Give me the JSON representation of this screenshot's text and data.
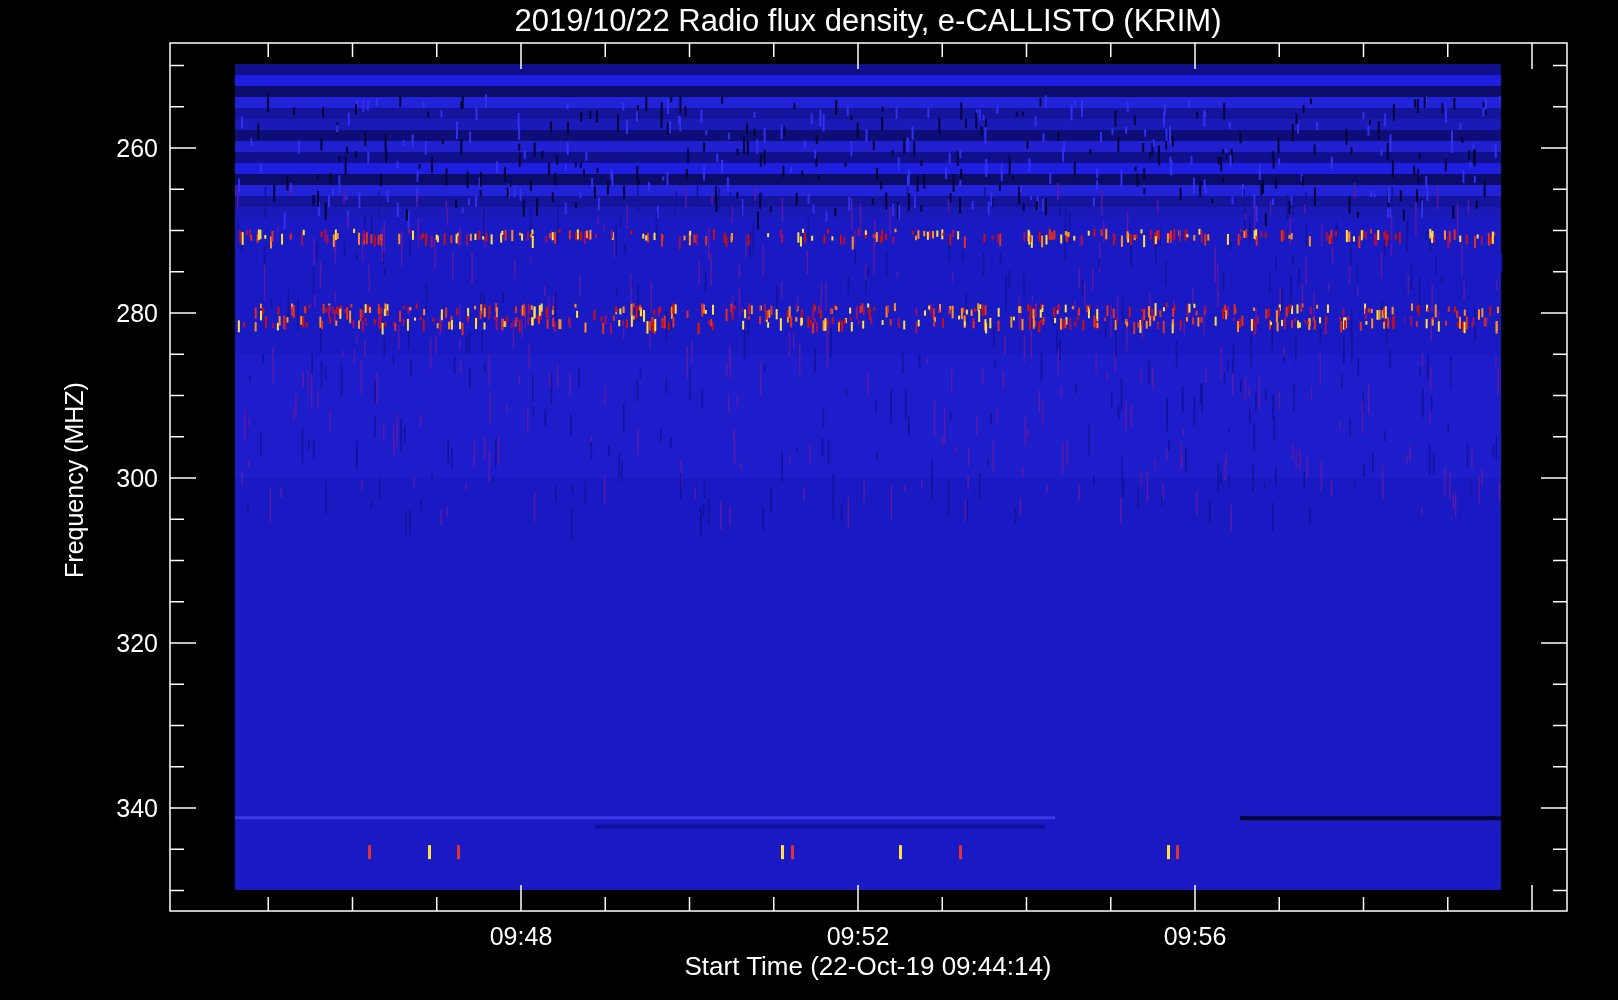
{
  "plot": {
    "title": "2019/10/22  Radio flux density, e-CALLISTO (KRIM)",
    "y_axis": {
      "label": "Frequency (MHZ)",
      "ticks": [
        "260",
        "280",
        "300",
        "320",
        "340"
      ]
    },
    "x_axis": {
      "label": "Start Time (22-Oct-19 09:44:14)",
      "ticks": [
        "09:48",
        "09:52",
        "09:56"
      ]
    }
  }
}
